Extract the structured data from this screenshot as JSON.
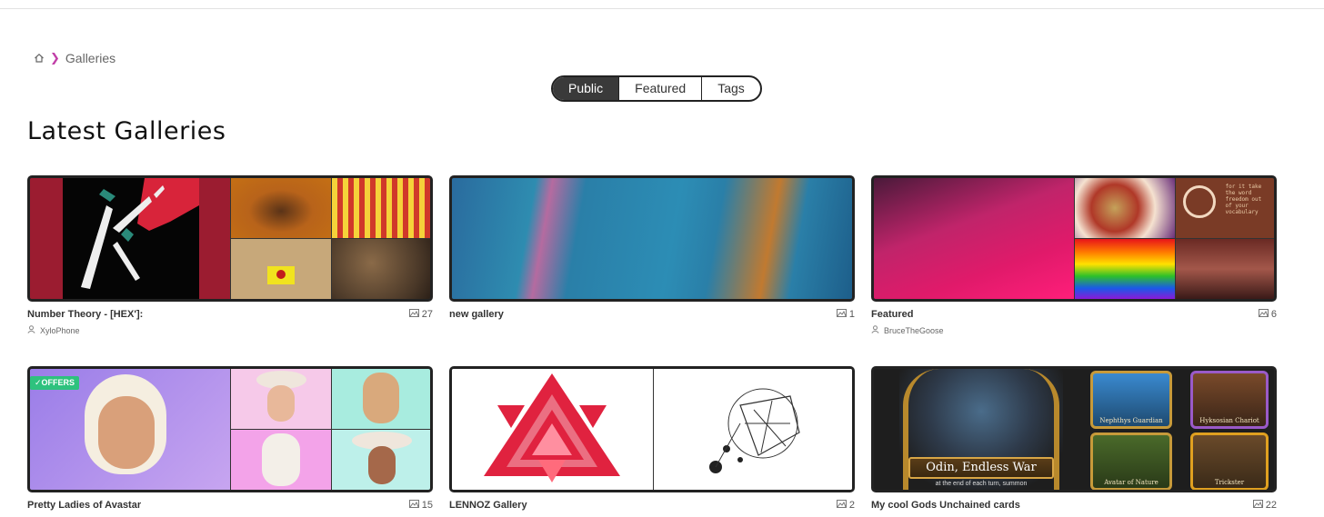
{
  "breadcrumb": {
    "current": "Galleries"
  },
  "tabs": [
    {
      "label": "Public",
      "active": true
    },
    {
      "label": "Featured",
      "active": false
    },
    {
      "label": "Tags",
      "active": false
    }
  ],
  "page_title": "Latest Galleries",
  "galleries": [
    {
      "name": "Number Theory - [HEX']:",
      "count": "27",
      "owner": "XyloPhone"
    },
    {
      "name": "new gallery",
      "count": "1",
      "owner": ""
    },
    {
      "name": "Featured",
      "count": "6",
      "owner": "BruceTheGoose"
    },
    {
      "name": "Pretty Ladies of Avastar",
      "count": "15",
      "owner": "",
      "badge": "✓OFFERS"
    },
    {
      "name": "LENNOZ Gallery",
      "count": "2",
      "owner": ""
    },
    {
      "name": "My cool Gods Unchained cards",
      "count": "22",
      "owner": ""
    }
  ],
  "thumb_text": {
    "odin_title": "Odin, Endless War",
    "odin_sub": "at the end of each turn, summon",
    "nephthys": "Nephthys Guardian",
    "hyksosian": "Hyksosian Chariot",
    "avatar_nature": "Avatar of Nature",
    "orange_card": "Trickster",
    "poem": "for it take the word freedom out of your vocabulary"
  },
  "colors": {
    "accent": "#c13fa8",
    "offers_badge": "#2ec27e",
    "active_tab": "#3a3a3a"
  }
}
